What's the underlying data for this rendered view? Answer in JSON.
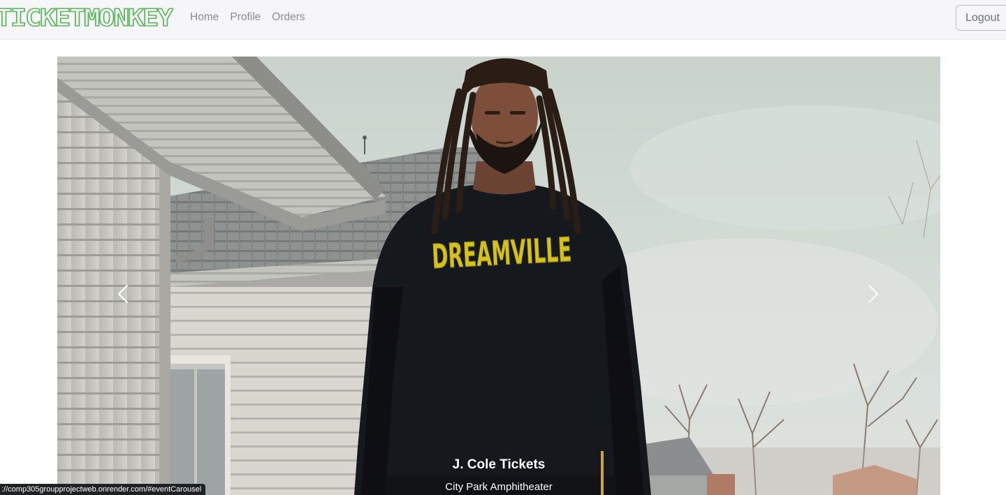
{
  "brand": {
    "logo_text": "TICKETMONKEY",
    "color": "#5fb85f"
  },
  "nav": {
    "links": [
      "Home",
      "Profile",
      "Orders"
    ],
    "logout_label": "Logout"
  },
  "carousel": {
    "slide": {
      "title": "J. Cole Tickets",
      "subtitle": "City Park Amphitheater",
      "sweater_text": "DREAMVILLE"
    },
    "controls": {
      "prev_icon": "chevron-left-icon",
      "next_icon": "chevron-right-icon"
    }
  },
  "status_bar": {
    "url": "://comp305groupprojectweb.onrender.com/#eventCarousel"
  }
}
